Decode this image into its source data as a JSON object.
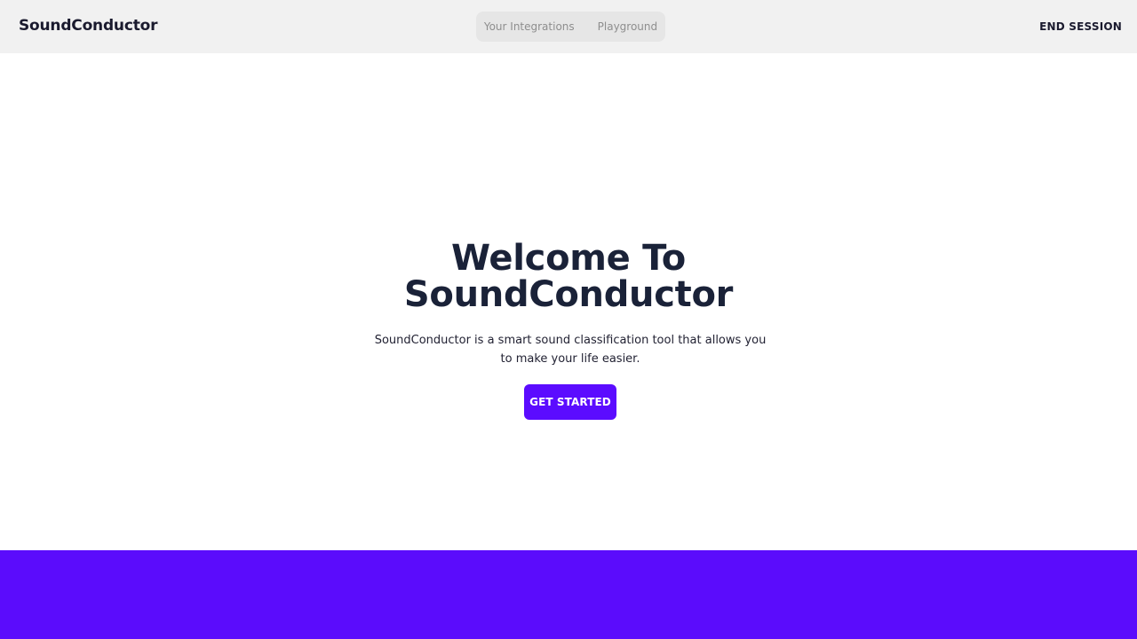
{
  "colors": {
    "navbar_bg": "#f1f1f1",
    "nav_pill_bg": "#e6e6e6",
    "accent": "#5b0cff",
    "footer_band": "#5b0cfc",
    "title_text": "#1a2238"
  },
  "navbar": {
    "brand": "SoundConductor",
    "links": [
      {
        "label": "Your Integrations"
      },
      {
        "label": "Playground"
      }
    ],
    "end_session_label": "END SESSION"
  },
  "hero": {
    "title_line1": "Welcome To",
    "title_line2": "SoundConductor",
    "description": "SoundConductor is a smart sound classification tool that allows you to make your life easier.",
    "cta_label": "GET STARTED"
  }
}
